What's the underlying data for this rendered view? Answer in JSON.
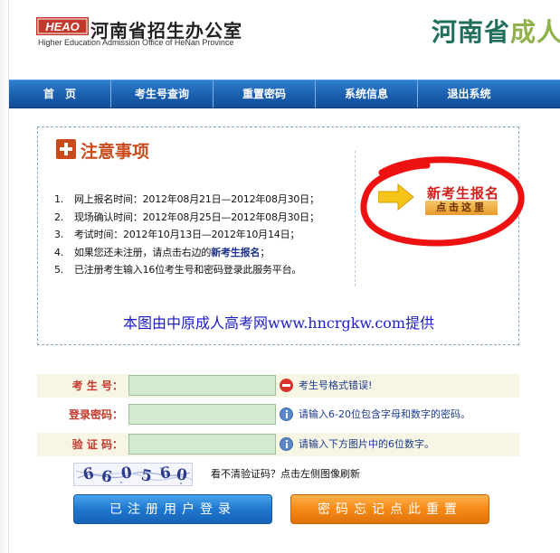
{
  "header": {
    "logo_mark": "HEAO",
    "org_name_cn": "河南省招生办公室",
    "org_name_en": "Higher Education Admission Office of HeNan Province",
    "brand_title_part1": "河南省",
    "brand_title_part2": "成人"
  },
  "nav": {
    "items": [
      {
        "label": "首　页"
      },
      {
        "label": "考生号查询"
      },
      {
        "label": "重置密码"
      },
      {
        "label": "系统信息"
      },
      {
        "label": "退出系统"
      }
    ]
  },
  "notice": {
    "title": "注意事项",
    "items": [
      {
        "num": "1.",
        "text": "网上报名时间：2012年08月21日—2012年08月30日；"
      },
      {
        "num": "2.",
        "text": "现场确认时间：2012年08月25日—2012年08月30日；"
      },
      {
        "num": "3.",
        "text": "考试时间：2012年10月13日—2012年10月14日；"
      },
      {
        "num": "4.",
        "text_before": "如果您还未注册，请点击右边的",
        "highlight": "新考生报名",
        "text_after": "；"
      },
      {
        "num": "5.",
        "text": "已注册考生输入16位考生号和密码登录此服务平台。"
      }
    ],
    "register_title": "新考生报名",
    "register_sub": "点击这里",
    "watermark": "本图由中原成人高考网www.hncrgkw.com提供"
  },
  "form": {
    "exam_id": {
      "label": "考 生 号：",
      "value": "",
      "message": "考生号格式错误!",
      "status": "error"
    },
    "password": {
      "label": "登录密码：",
      "value": "",
      "message": "请输入6-20位包含字母和数字的密码。",
      "status": "info"
    },
    "captcha": {
      "label": "验 证 码：",
      "value": "",
      "message": "请输入下方图片中的6位数字。",
      "status": "info"
    },
    "captcha_digits": [
      "6",
      "6",
      "0",
      "5",
      "6",
      "0"
    ],
    "captcha_hint": "看不清验证码？点击左侧图像刷新",
    "login_button": "已注册用户登录",
    "reset_button": "密码忘记点此重置"
  },
  "colors": {
    "nav_blue": "#1a5fae",
    "notice_red": "#c94a1a",
    "brand_green": "#1f6f5c",
    "brand_light_green": "#8fb24a",
    "input_green": "#d2ebcf",
    "login_blue": "#1f78cf",
    "reset_orange": "#f58a18"
  }
}
